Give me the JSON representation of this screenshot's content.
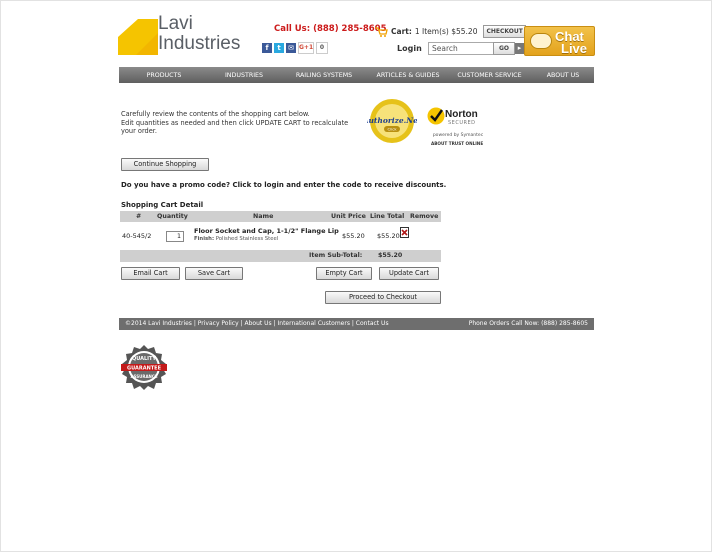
{
  "brand": {
    "line1": "Lavi",
    "line2": "Industries"
  },
  "header": {
    "call_us": "Call Us: (888) 285-8605",
    "cart_label": "Cart:",
    "cart_summary": "1 Item(s) $55.20",
    "checkout_label": "CHECKOUT",
    "social_count": "0",
    "gplus_label": "G+1",
    "login_label": "Login",
    "search_placeholder": "Search",
    "go_label": "GO",
    "chat_line1": "Chat",
    "chat_line2": "Live"
  },
  "nav": [
    "PRODUCTS",
    "INDUSTRIES",
    "RAILING SYSTEMS",
    "ARTICLES & GUIDES",
    "CUSTOMER SERVICE",
    "ABOUT US"
  ],
  "intro": {
    "line1": "Carefully review the contents of the shopping cart below.",
    "line2": "Edit quantities as needed and then click UPDATE CART to recalculate",
    "line3": "your order."
  },
  "trust": {
    "authnet_name": "Authorize.Net",
    "authnet_click": "Click",
    "norton_name": "Norton",
    "norton_secured": "SECURED",
    "norton_powered": "powered by Symantec",
    "about_trust": "ABOUT TRUST ONLINE"
  },
  "continue_label": "Continue Shopping",
  "promo_text": "Do you have a promo code? Click to login and enter the code to receive discounts.",
  "cart_title": "Shopping Cart Detail",
  "table": {
    "headers": [
      "#",
      "Quantity",
      "Name",
      "Unit Price",
      "Line Total",
      "Remove"
    ],
    "rows": [
      {
        "sku": "40-545/2",
        "qty": "1",
        "name": "Floor Socket and Cap, 1-1/2\" Flange Lip",
        "finish_label": "Finish:",
        "finish": "Polished Stainless Steel",
        "unit_price": "$55.20",
        "line_total": "$55.20"
      }
    ],
    "subtotal_label": "Item Sub-Total:",
    "subtotal": "$55.20"
  },
  "buttons": {
    "email": "Email Cart",
    "save": "Save Cart",
    "empty": "Empty Cart",
    "update": "Update Cart",
    "checkout": "Proceed to Checkout"
  },
  "footer": {
    "left": "©2014 Lavi Industries | Privacy Policy | About Us | International Customers | Contact Us",
    "right": "Phone Orders Call Now: (888) 285-8605"
  },
  "badge": {
    "top": "QUALITY",
    "middle": "GUARANTEE",
    "bottom": "ASSURANCE"
  },
  "colors": {
    "accent_red": "#cc1b1b",
    "logo_yellow": "#f5c400",
    "nav_gray": "#6e6e6e"
  }
}
